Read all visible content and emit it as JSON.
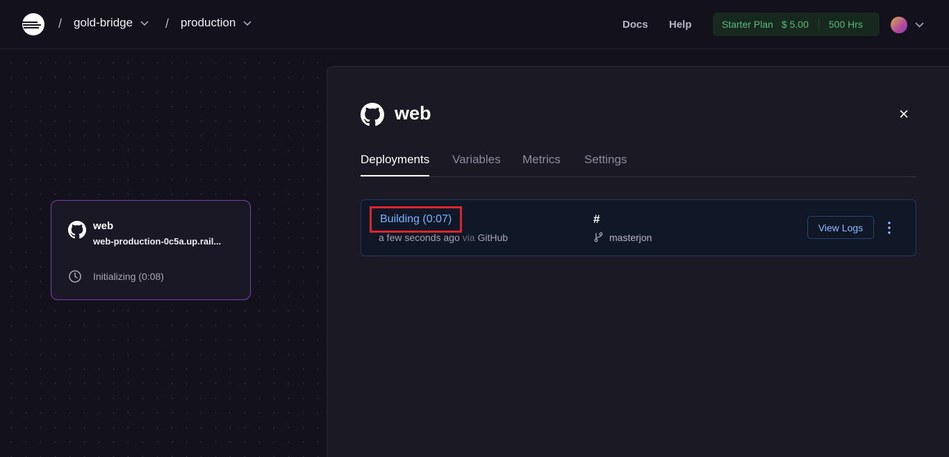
{
  "header": {
    "project": "gold-bridge",
    "environment": "production",
    "separator": "/",
    "nav": {
      "docs": "Docs",
      "help": "Help"
    },
    "plan": {
      "name": "Starter Plan",
      "price": "$ 5.00",
      "hours": "500 Hrs"
    }
  },
  "canvas": {
    "service_card": {
      "title": "web",
      "url": "web-production-0c5a.up.rail...",
      "status": "Initializing (0:08)"
    }
  },
  "panel": {
    "title": "web",
    "tabs": [
      {
        "label": "Deployments"
      },
      {
        "label": "Variables"
      },
      {
        "label": "Metrics"
      },
      {
        "label": "Settings"
      }
    ],
    "deployment": {
      "status": "Building (0:07)",
      "time": "a few seconds ago",
      "via": "via",
      "source": "GitHub",
      "commit": "#",
      "branch": "masterjon",
      "view_logs": "View Logs"
    }
  },
  "colors": {
    "background": "#13111c",
    "panel": "#1b1a24",
    "accent_purple": "#7b3fb3",
    "link_blue": "#7ab3ff",
    "plan_green": "#58b87d",
    "highlight_red": "#e0242b"
  },
  "icons": [
    "railway-logo-icon",
    "chevron-down-icon",
    "github-icon",
    "clock-icon",
    "close-icon",
    "git-branch-icon",
    "more-vertical-icon"
  ]
}
